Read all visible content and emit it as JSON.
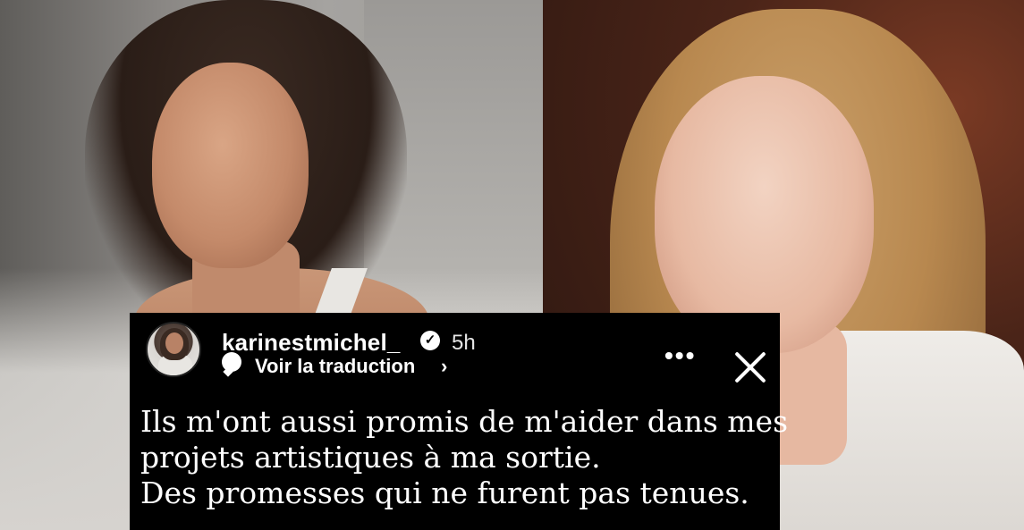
{
  "story": {
    "username": "karinestmichel_",
    "verified_icon": "verified-check-icon",
    "time_ago": "5h",
    "translate_label": "Voir la traduction",
    "chevron": "›",
    "more_label": "•••",
    "caption_lines": [
      "Ils m'ont aussi promis de m'aider dans mes",
      "projets artistiques à ma sortie.",
      "Des promesses qui ne furent pas tenues."
    ]
  },
  "colors": {
    "overlay_background": "#000000",
    "text": "#ffffff"
  }
}
